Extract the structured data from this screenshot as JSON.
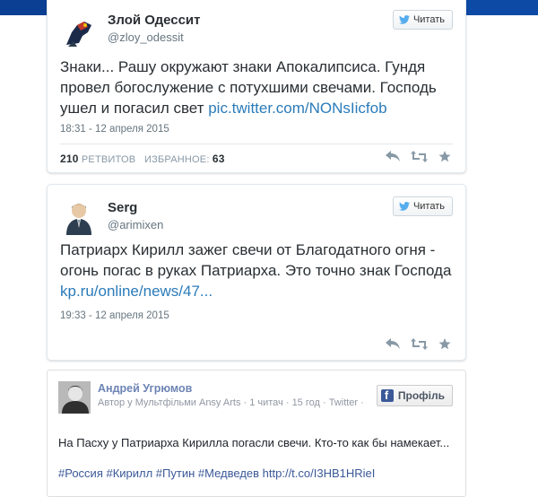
{
  "tweets": [
    {
      "author_name": "Злой Одессит",
      "handle": "@zloy_odessit",
      "follow_label": "Читать",
      "text_before_link": "Знаки... Рашу окружают знаки Апокалипсиса. Гундя провел богослужение с потухшими свечами. Господь ушел и погасил свет ",
      "link": "pic.twitter.com/NONsIicfob",
      "timestamp": "18:31 - 12 апреля 2015",
      "retweets_count": "210",
      "retweets_label": "РЕТВИТОВ",
      "favorites_label": "ИЗБРАННОЕ:",
      "favorites_count": "63"
    },
    {
      "author_name": "Serg",
      "handle": "@arimixen",
      "follow_label": "Читать",
      "text_before_link": "Патриарх Кирилл зажег свечи от Благодатного огня - огонь погас в руках Патриарха. Это точно знак Господа ",
      "link": "kp.ru/online/news/47...",
      "timestamp": "19:33 - 12 апреля 2015"
    }
  ],
  "fb_post": {
    "author_name": "Андрей Угрюмов",
    "meta": "Автор у Мультфільми Ansy Arts · 1 читач · 15 год · Twitter ·",
    "profile_button": "Профіль",
    "text": "На Пасху у Патриарха Кирилла погасли свечи. Кто-то как бы намекает...",
    "hashtags": "#Россия #Кирилл #Путин #Медведев http://t.co/I3HB1HRieI"
  },
  "colors": {
    "link": "#2b7bb9",
    "facebook": "#3b5998",
    "top_bar": "#0a3f94"
  },
  "icons": [
    "twitter-bird-icon",
    "reply-icon",
    "retweet-icon",
    "favorite-star-icon",
    "facebook-logo-icon"
  ]
}
